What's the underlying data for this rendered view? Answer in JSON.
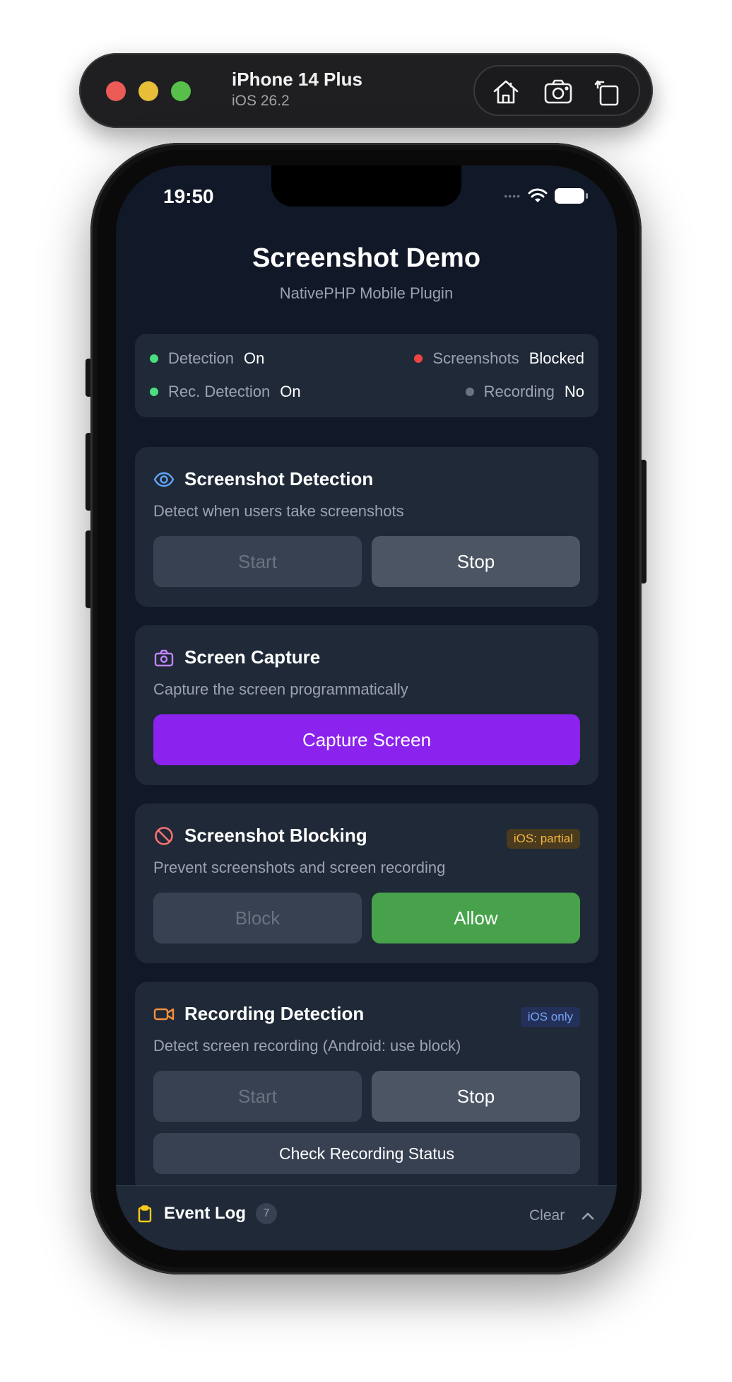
{
  "simulator": {
    "device_name": "iPhone 14 Plus",
    "os_version": "iOS 26.2",
    "buttons": [
      "home-icon",
      "screenshot-icon",
      "rotate-icon"
    ]
  },
  "status_bar": {
    "time": "19:50"
  },
  "header": {
    "title": "Screenshot Demo",
    "subtitle": "NativePHP Mobile Plugin"
  },
  "status": {
    "detection": {
      "label": "Detection",
      "value": "On",
      "color": "#4ade80"
    },
    "rec_detection": {
      "label": "Rec. Detection",
      "value": "On",
      "color": "#4ade80"
    },
    "screenshots": {
      "label": "Screenshots",
      "value": "Blocked",
      "color": "#ef4444"
    },
    "recording": {
      "label": "Recording",
      "value": "No",
      "color": "#6b7280"
    }
  },
  "cards": {
    "detection": {
      "title": "Screenshot Detection",
      "description": "Detect when users take screenshots",
      "start_label": "Start",
      "stop_label": "Stop",
      "icon": "eye-icon"
    },
    "capture": {
      "title": "Screen Capture",
      "description": "Capture the screen programmatically",
      "button_label": "Capture Screen",
      "icon": "camera-icon"
    },
    "blocking": {
      "title": "Screenshot Blocking",
      "badge": "iOS: partial",
      "description": "Prevent screenshots and screen recording",
      "block_label": "Block",
      "allow_label": "Allow",
      "icon": "ban-icon"
    },
    "recording": {
      "title": "Recording Detection",
      "badge": "iOS only",
      "description": "Detect screen recording (Android: use block)",
      "start_label": "Start",
      "stop_label": "Stop",
      "check_label": "Check Recording Status",
      "icon": "video-icon"
    }
  },
  "event_log": {
    "title": "Event Log",
    "count": "7",
    "clear_label": "Clear",
    "icon": "clipboard-icon"
  },
  "colors": {
    "background": "#111827",
    "card": "#1f2937",
    "accent_purple": "#8b22ee",
    "accent_green": "#47a24b"
  }
}
